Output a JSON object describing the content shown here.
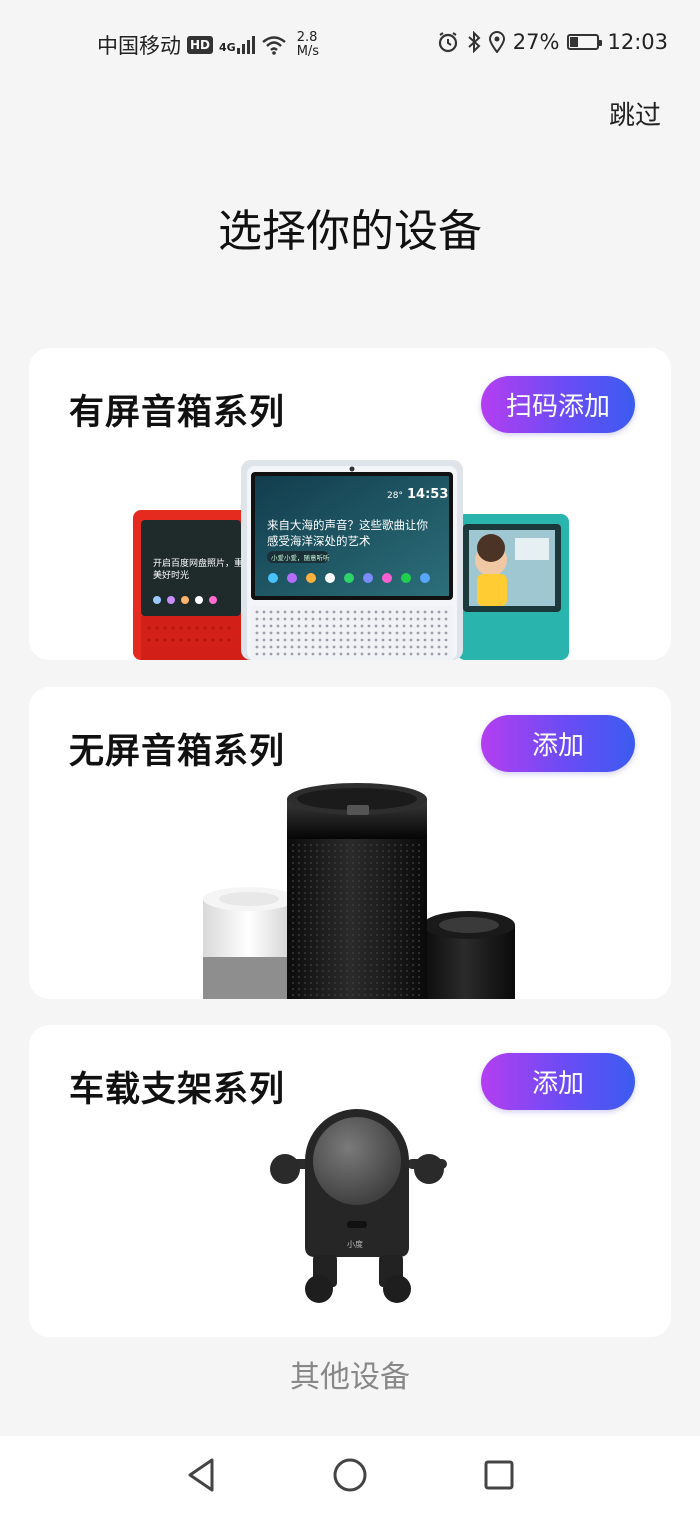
{
  "status_bar": {
    "carrier": "中国移动",
    "hd": "HD",
    "network": "4G",
    "speed_value": "2.8",
    "speed_unit": "M/s",
    "battery_percent": "27%",
    "battery_level": 0.27,
    "time": "12:03",
    "icons": [
      "alarm-icon",
      "bluetooth-icon",
      "location-icon",
      "battery-icon",
      "wifi-icon",
      "signal-icon"
    ]
  },
  "header": {
    "skip_label": "跳过",
    "title": "选择你的设备"
  },
  "cards": [
    {
      "title": "有屏音箱系列",
      "button": "扫码添加",
      "screen_caption_line1": "来自大海的声音？这些歌曲让你",
      "screen_caption_line2": "感受海洋深处的艺术",
      "screen_time": "14:53",
      "screen_weather": "28°",
      "screen_hint": "小爱小爱，随意听听",
      "left_screen_line1": "开启百度网盘照片，重",
      "left_screen_line2": "美好时光"
    },
    {
      "title": "无屏音箱系列",
      "button": "添加"
    },
    {
      "title": "车载支架系列",
      "button": "添加",
      "device_logo": "小度"
    }
  ],
  "footer": {
    "other_devices": "其他设备"
  },
  "nav_bar": {
    "icons": [
      "back-icon",
      "home-icon",
      "recents-icon"
    ]
  },
  "colors": {
    "button_gradient_start": "#b43ef0",
    "button_gradient_end": "#3b5cf0",
    "background": "#f5f5f5"
  }
}
